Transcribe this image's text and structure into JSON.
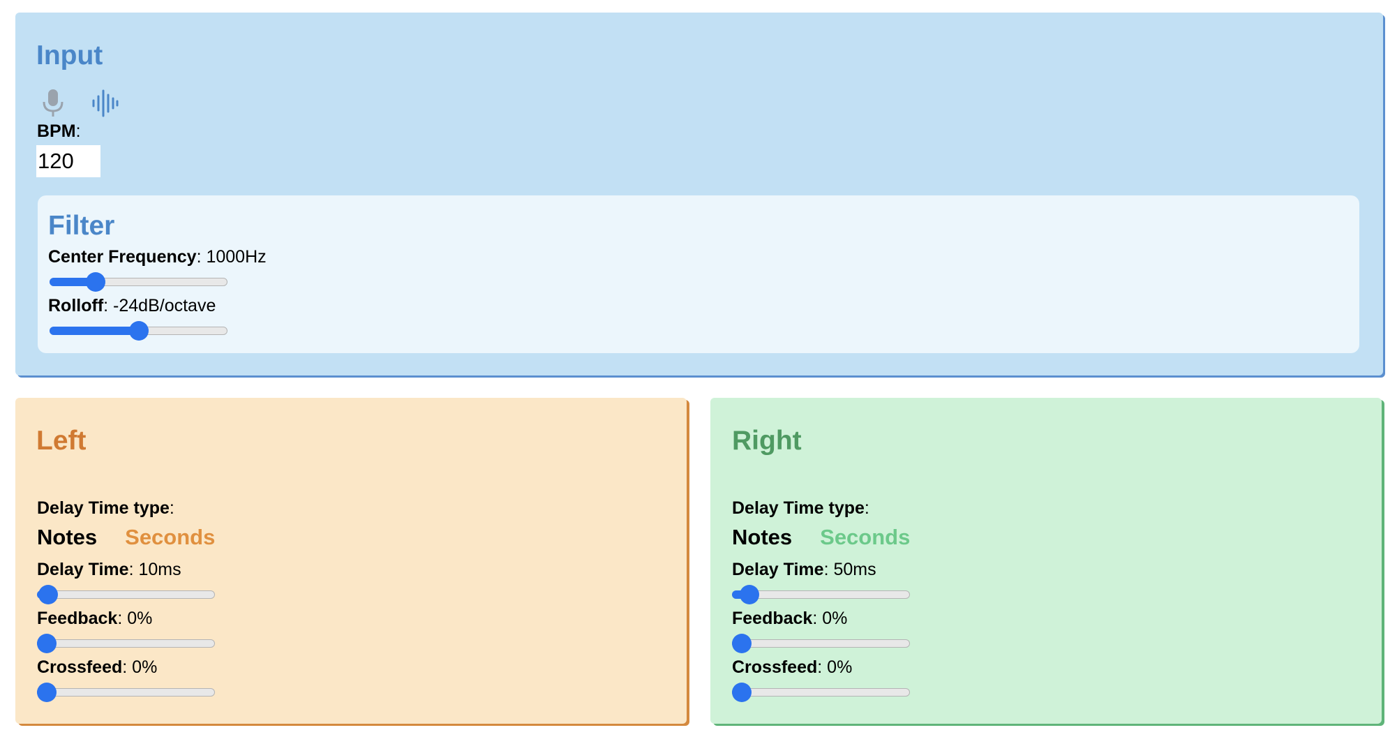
{
  "colors": {
    "input_bg": "#c2e0f4",
    "filter_bg": "#ecf6fc",
    "left_bg": "#fbe7c7",
    "right_bg": "#cff2d8",
    "slider_accent": "#2b73ee",
    "input_title": "#4a86c8",
    "left_title": "#d07a32",
    "right_title": "#4f9a62"
  },
  "input": {
    "title": "Input",
    "icons": [
      "microphone-icon",
      "waveform-icon"
    ],
    "bpm_label": "BPM",
    "bpm_value": "120"
  },
  "filter": {
    "title": "Filter",
    "center_frequency": {
      "label": "Center Frequency",
      "value": "1000Hz",
      "level": 0.23
    },
    "rolloff": {
      "label": "Rolloff",
      "value": "-24dB/octave",
      "level": 0.5
    }
  },
  "left": {
    "title": "Left",
    "delay_type_label": "Delay Time type",
    "option_notes": "Notes",
    "option_seconds": "Seconds",
    "delay_time": {
      "label": "Delay Time",
      "value": "10ms",
      "level": 0.01
    },
    "feedback": {
      "label": "Feedback",
      "value": "0%",
      "level": 0.0
    },
    "crossfeed": {
      "label": "Crossfeed",
      "value": "0%",
      "level": 0.0
    }
  },
  "right": {
    "title": "Right",
    "delay_type_label": "Delay Time type",
    "option_notes": "Notes",
    "option_seconds": "Seconds",
    "delay_time": {
      "label": "Delay Time",
      "value": "50ms",
      "level": 0.05
    },
    "feedback": {
      "label": "Feedback",
      "value": "0%",
      "level": 0.0
    },
    "crossfeed": {
      "label": "Crossfeed",
      "value": "0%",
      "level": 0.0
    }
  }
}
